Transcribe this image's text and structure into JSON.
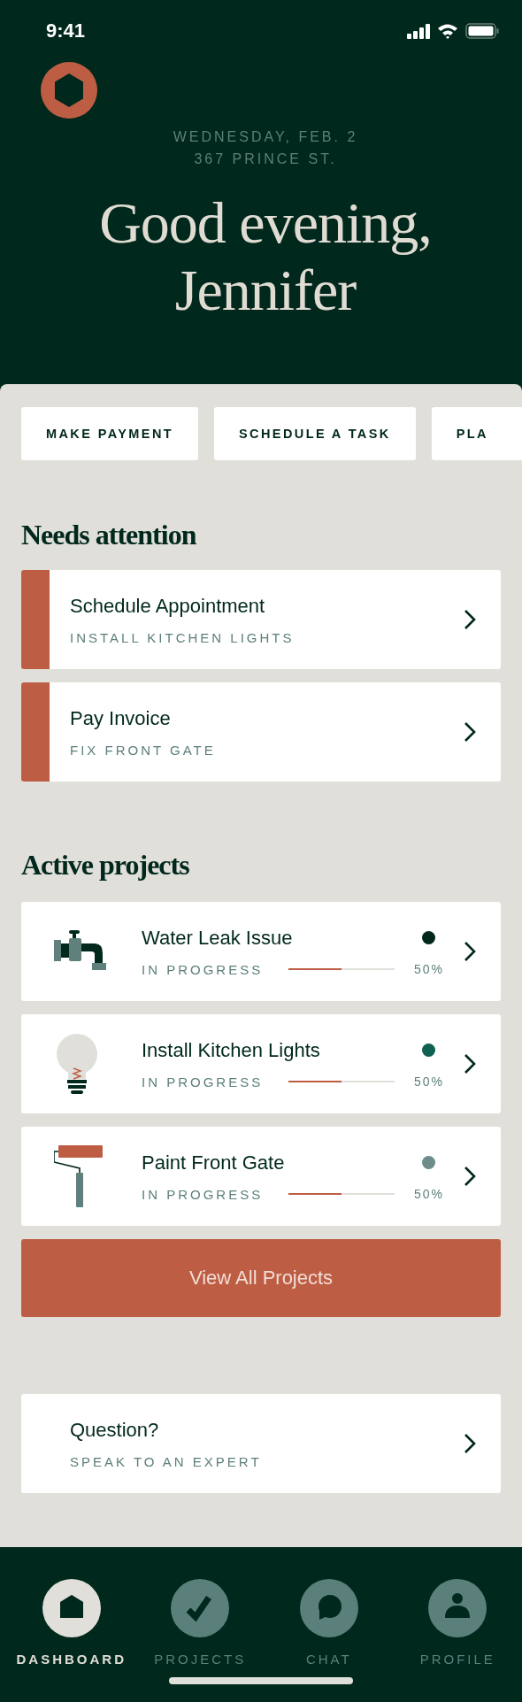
{
  "status_bar": {
    "time": "9:41"
  },
  "header": {
    "date": "WEDNESDAY, FEB. 2",
    "address": "367 PRINCE ST.",
    "greeting": "Good evening, Jennifer"
  },
  "quick_actions": [
    "MAKE PAYMENT",
    "SCHEDULE A TASK",
    "PLA"
  ],
  "needs_attention": {
    "title": "Needs attention",
    "items": [
      {
        "title": "Schedule Appointment",
        "subtitle": "INSTALL KITCHEN LIGHTS"
      },
      {
        "title": "Pay Invoice",
        "subtitle": "FIX FRONT GATE"
      }
    ]
  },
  "active_projects": {
    "title": "Active projects",
    "items": [
      {
        "kind": "faucet",
        "title": "Water Leak Issue",
        "status": "IN PROGRESS",
        "level": 0.5,
        "percent": "50%",
        "color": "#01281c"
      },
      {
        "kind": "bulb",
        "title": "Install Kitchen Lights",
        "status": "IN PROGRESS",
        "level": 0.5,
        "percent": "50%",
        "color": "#0e6050"
      },
      {
        "kind": "roller",
        "title": "Paint Front Gate",
        "status": "IN PROGRESS",
        "level": 0.5,
        "percent": "50%",
        "color": "#6e8c89"
      }
    ]
  },
  "view_all_button": "View All Projects",
  "question_card": {
    "title": "Question?",
    "subtitle": "SPEAK TO AN EXPERT"
  },
  "nav": [
    {
      "kind": "home",
      "label": "DASHBOARD",
      "selected": true
    },
    {
      "kind": "check",
      "label": "PROJECTS",
      "selected": false
    },
    {
      "kind": "chat",
      "label": "CHAT",
      "selected": false
    },
    {
      "kind": "person",
      "label": "PROFILE",
      "selected": false
    }
  ]
}
